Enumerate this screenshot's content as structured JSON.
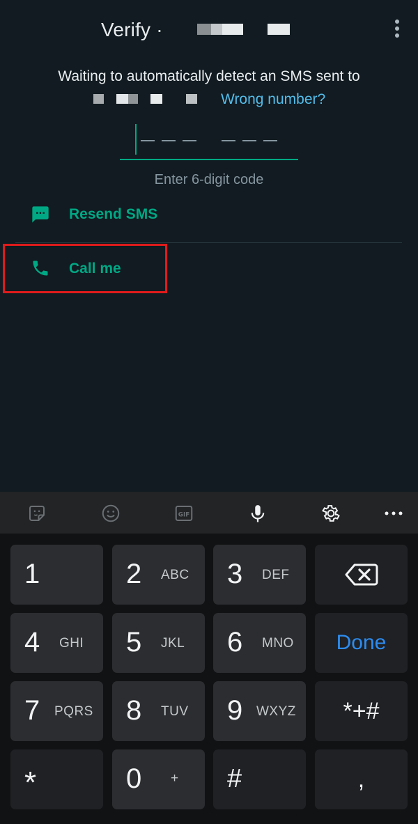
{
  "header": {
    "title": "Verify",
    "title_separator": "·",
    "menu_icon": "more-vert-icon"
  },
  "verification": {
    "waiting_text": "Waiting to automatically detect an SMS sent to",
    "wrong_number_link": "Wrong number?",
    "code_hint": "Enter 6-digit code"
  },
  "options": {
    "resend_sms_label": "Resend SMS",
    "resend_sms_icon": "sms-icon",
    "call_me_label": "Call me",
    "call_me_icon": "phone-icon"
  },
  "keyboard": {
    "toolbar": [
      "sticker-icon",
      "emoji-icon",
      "gif-icon",
      "mic-icon",
      "settings-icon",
      "more-icon"
    ],
    "gif_label": "GIF",
    "keys": {
      "k1": {
        "num": "1",
        "letters": ""
      },
      "k2": {
        "num": "2",
        "letters": "ABC"
      },
      "k3": {
        "num": "3",
        "letters": "DEF"
      },
      "k4": {
        "num": "4",
        "letters": "GHI"
      },
      "k5": {
        "num": "5",
        "letters": "JKL"
      },
      "k6": {
        "num": "6",
        "letters": "MNO"
      },
      "k7": {
        "num": "7",
        "letters": "PQRS"
      },
      "k8": {
        "num": "8",
        "letters": "TUV"
      },
      "k9": {
        "num": "9",
        "letters": "WXYZ"
      },
      "k0": {
        "num": "0",
        "letters": "+"
      },
      "star": "*",
      "hash": "#",
      "comma": ",",
      "symbols": "*+#",
      "done": "Done"
    }
  },
  "colors": {
    "accent": "#00a884",
    "link": "#53bdeb",
    "highlight": "#e01b1b",
    "done": "#2d8cf0"
  }
}
